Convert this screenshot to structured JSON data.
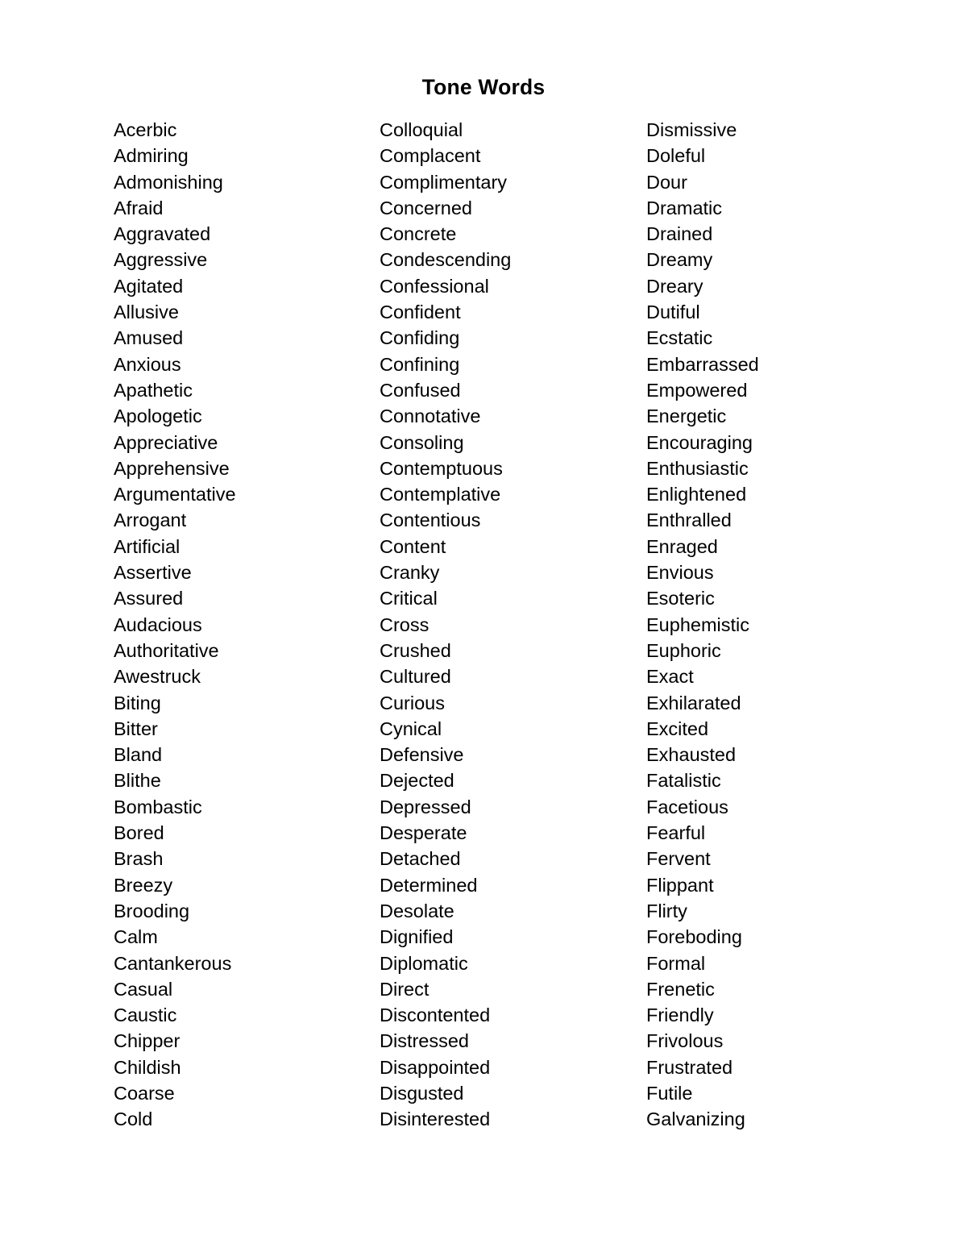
{
  "document": {
    "title": "Tone Words",
    "page_background": "#ffffff",
    "text_color": "#000000",
    "column_count": 3,
    "rows_per_column": 39,
    "total_words": 117
  },
  "columns": [
    {
      "name": "column-1",
      "words": [
        "Acerbic",
        "Admiring",
        "Admonishing",
        "Afraid",
        "Aggravated",
        "Aggressive",
        "Agitated",
        "Allusive",
        "Amused",
        "Anxious",
        "Apathetic",
        "Apologetic",
        "Appreciative",
        "Apprehensive",
        "Argumentative",
        "Arrogant",
        "Artificial",
        "Assertive",
        "Assured",
        "Audacious",
        "Authoritative",
        "Awestruck",
        "Biting",
        "Bitter",
        "Bland",
        "Blithe",
        "Bombastic",
        "Bored",
        "Brash",
        "Breezy",
        "Brooding",
        "Calm",
        "Cantankerous",
        "Casual",
        "Caustic",
        "Chipper",
        "Childish",
        "Coarse",
        "Cold"
      ]
    },
    {
      "name": "column-2",
      "words": [
        "Colloquial",
        "Complacent",
        "Complimentary",
        "Concerned",
        "Concrete",
        "Condescending",
        "Confessional",
        "Confident",
        "Confiding",
        "Confining",
        "Confused",
        "Connotative",
        "Consoling",
        "Contemptuous",
        "Contemplative",
        "Contentious",
        "Content",
        "Cranky",
        "Critical",
        "Cross",
        "Crushed",
        "Cultured",
        "Curious",
        "Cynical",
        "Defensive",
        "Dejected",
        "Depressed",
        "Desperate",
        "Detached",
        "Determined",
        "Desolate",
        "Dignified",
        "Diplomatic",
        "Direct",
        "Discontented",
        "Distressed",
        "Disappointed",
        "Disgusted",
        "Disinterested"
      ]
    },
    {
      "name": "column-3",
      "words": [
        "Dismissive",
        "Doleful",
        "Dour",
        "Dramatic",
        "Drained",
        "Dreamy",
        "Dreary",
        "Dutiful",
        "Ecstatic",
        "Embarrassed",
        "Empowered",
        "Energetic",
        "Encouraging",
        "Enthusiastic",
        "Enlightened",
        "Enthralled",
        "Enraged",
        "Envious",
        "Esoteric",
        "Euphemistic",
        "Euphoric",
        "Exact",
        "Exhilarated",
        "Excited",
        "Exhausted",
        "Fatalistic",
        "Facetious",
        "Fearful",
        "Fervent",
        "Flippant",
        "Flirty",
        "Foreboding",
        "Formal",
        "Frenetic",
        "Friendly",
        "Frivolous",
        "Frustrated",
        "Futile",
        "Galvanizing"
      ]
    }
  ]
}
